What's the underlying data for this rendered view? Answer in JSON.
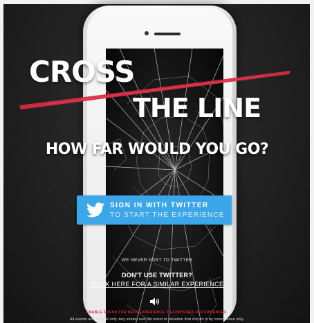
{
  "hero": {
    "title_line1": "CROSS",
    "title_line2": "THE LINE",
    "subtitle": "HOW FAR WOULD YOU GO?",
    "slash_color": "#d42b45"
  },
  "twitter_button": {
    "line1": "SIGN IN WITH TWITTER",
    "line2": "TO START THE EXPERIENCE",
    "icon": "twitter-bird-icon",
    "color": "#3ca6e8"
  },
  "footer": {
    "never_post": "WE NEVER POST TO TWITTER",
    "dont_use": "DON'T USE TWITTER?",
    "alternative_link": "CLICK HERE FOR A SIMILAR EXPERIENCE",
    "sound_icon": "speaker-icon",
    "enable_sound": "ENABLE SOUND FOR BEST EXPERIENCE. HEADPHONES RECOMMENDED.",
    "disclaimer": "All events are fictional only. Any similar real life event or situation that occurs is by coincidence only."
  }
}
